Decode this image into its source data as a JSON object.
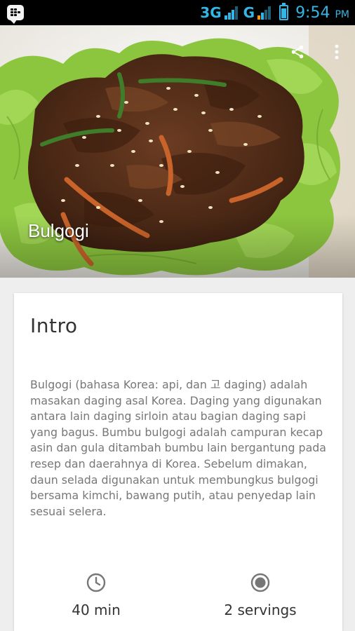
{
  "status_bar": {
    "network_1": "3G",
    "network_2": "G",
    "time": "9:54",
    "ampm": "PM",
    "accent_color": "#33b5e5"
  },
  "recipe": {
    "title": "Bulgogi",
    "actions": {
      "share_icon": "share-icon",
      "more_icon": "more-vert-icon"
    }
  },
  "intro": {
    "heading": "Intro",
    "text": "Bulgogi (bahasa Korea:   api, dan 고  daging) adalah masakan daging asal Korea. Daging yang digunakan antara lain daging sirloin atau bagian daging sapi yang bagus. Bumbu bulgogi adalah campuran kecap asin dan gula ditambah bumbu lain bergantung pada resep dan daerahnya di Korea. Sebelum dimakan, daun selada digunakan untuk membungkus bulgogi bersama kimchi, bawang putih, atau penyedap lain sesuai selera."
  },
  "meta": {
    "time": {
      "icon": "clock-icon",
      "label": "40 min"
    },
    "servings": {
      "icon": "servings-icon",
      "label": "2 servings"
    }
  }
}
